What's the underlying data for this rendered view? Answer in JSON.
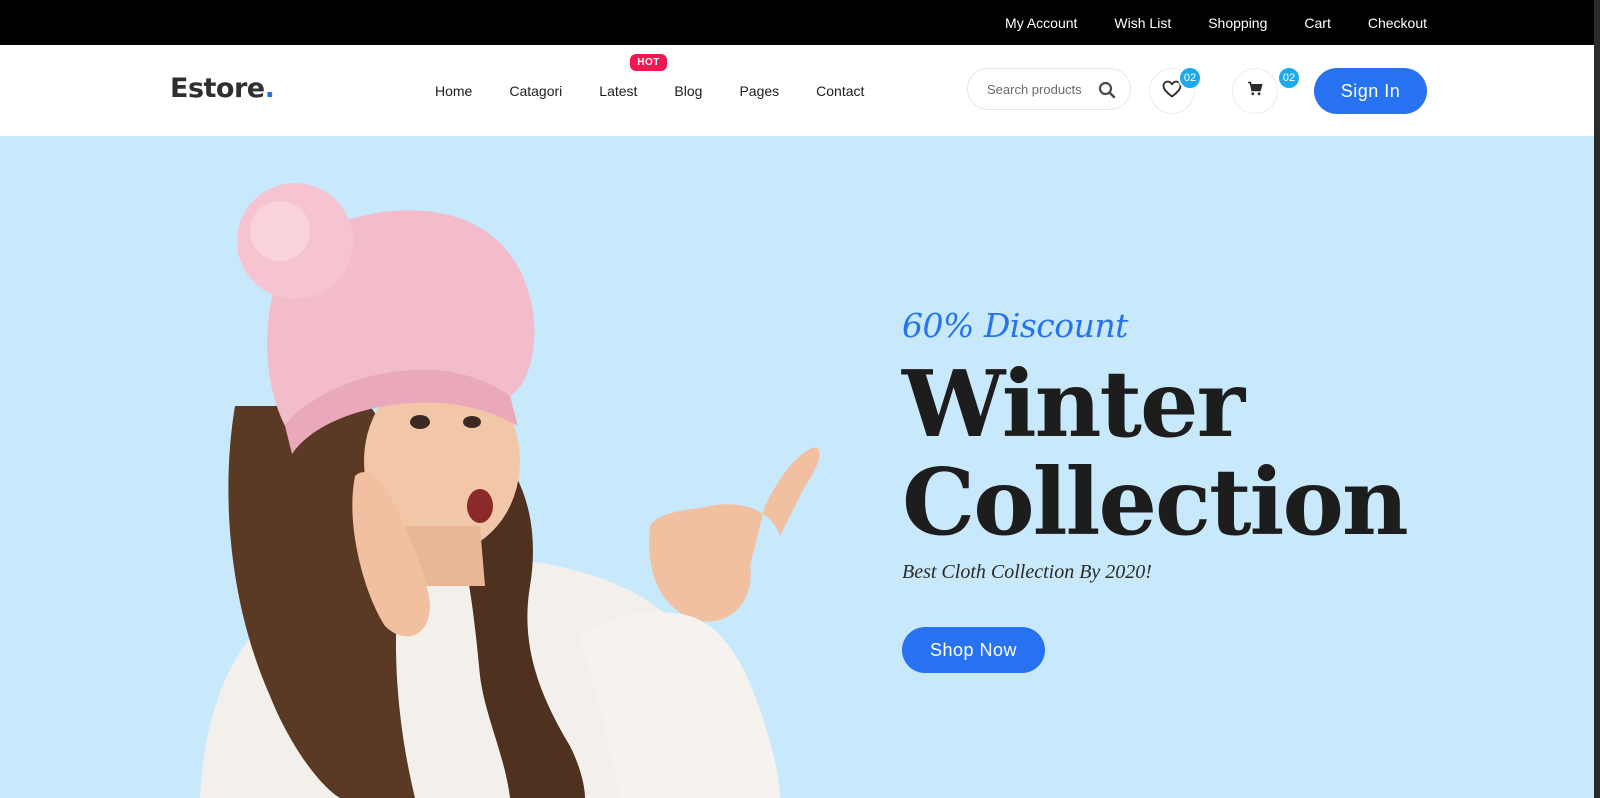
{
  "topbar": {
    "links": [
      "My Account",
      "Wish List",
      "Shopping",
      "Cart",
      "Checkout"
    ]
  },
  "header": {
    "logo": "Estore",
    "logo_dot": ".",
    "nav": [
      "Home",
      "Catagori",
      "Latest",
      "Blog",
      "Pages",
      "Contact"
    ],
    "hot_badge": "HOT",
    "search_placeholder": "Search products",
    "wishlist_count": "02",
    "cart_count": "02",
    "signin_label": "Sign In"
  },
  "hero": {
    "discount": "60% Discount",
    "title_line1": "Winter",
    "title_line2": "Collection",
    "subtitle": "Best Cloth Collection By 2020!",
    "cta_label": "Shop Now"
  },
  "colors": {
    "accent": "#2772f0",
    "hero_bg": "#c7e9fb",
    "badge_hot": "#f2184f",
    "badge_count": "#1da9ee"
  }
}
